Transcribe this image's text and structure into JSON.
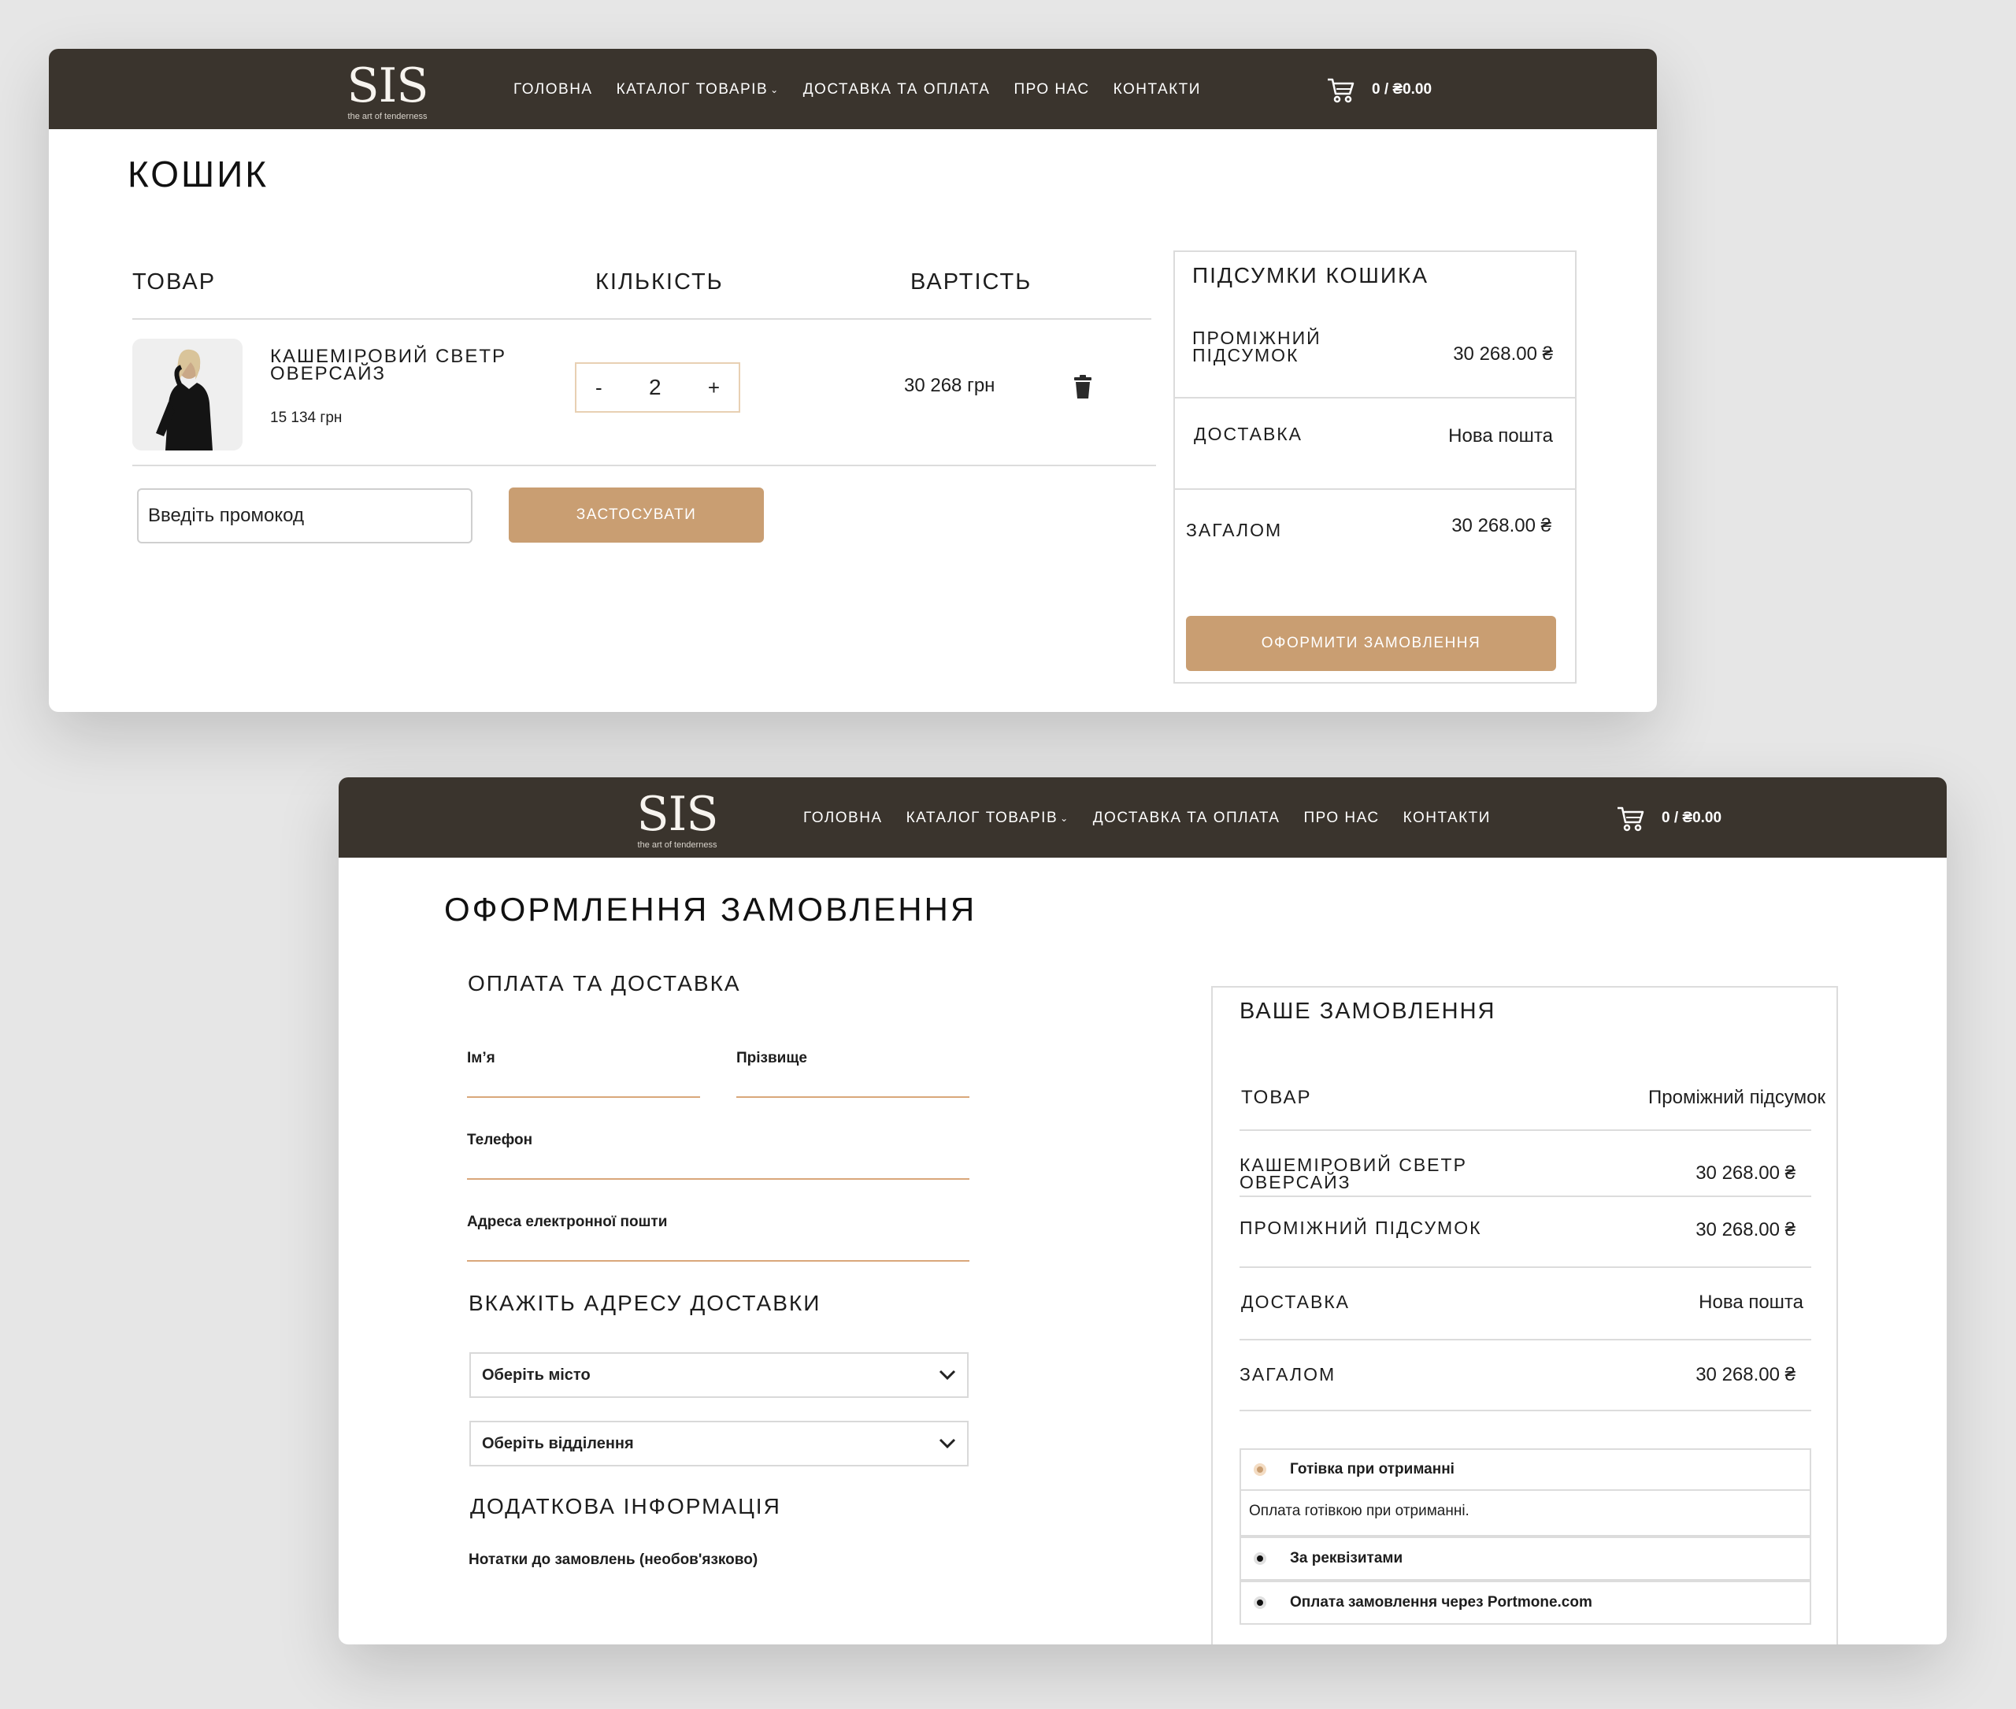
{
  "brand": {
    "logo": "SIS",
    "tagline": "the art of tenderness"
  },
  "nav": {
    "items": [
      "ГОЛОВНА",
      "КАТАЛОГ ТОВАРІВ",
      "ДОСТАВКА ТА ОПЛАТА",
      "ПРО НАС",
      "КОНТАКТИ"
    ],
    "cart": "0 / ₴0.00"
  },
  "cart_page": {
    "title": "КОШИК",
    "columns": {
      "product": "ТОВАР",
      "quantity": "КІЛЬКІСТЬ",
      "price": "ВАРТІСТЬ"
    },
    "item": {
      "name_line1": "КАШЕМІРОВИЙ СВЕТР",
      "name_line2": "ОВЕРСАЙЗ",
      "unit_price": "15 134 грн",
      "qty_minus": "-",
      "qty_value": "2",
      "qty_plus": "+",
      "total": "30 268 грн"
    },
    "promo_placeholder": "Введіть промокод",
    "apply_label": "ЗАСТОСУВАТИ",
    "totals": {
      "title": "ПІДСУМКИ КОШИКА",
      "subtotal_label_line1": "ПРОМІЖНИЙ",
      "subtotal_label_line2": "ПІДСУМОК",
      "subtotal_value": "30 268.00 ₴",
      "shipping_label": "ДОСТАВКА",
      "shipping_value": "Нова пошта",
      "total_label": "ЗАГАЛОМ",
      "total_value": "30 268.00 ₴",
      "checkout_label": "ОФОРМИТИ ЗАМОВЛЕННЯ"
    }
  },
  "checkout_page": {
    "title": "ОФОРМЛЕННЯ ЗАМОВЛЕННЯ",
    "payment_section": "ОПЛАТА ТА ДОСТАВКА",
    "first_name_label": "Ім’я",
    "last_name_label": "Прізвище",
    "phone_label": "Телефон",
    "email_label": "Адреса електронної пошти",
    "address_section": "ВКАЖІТЬ АДРЕСУ ДОСТАВКИ",
    "city_select": "Оберіть місто",
    "branch_select": "Оберіть відділення",
    "extra_section": "ДОДАТКОВА ІНФОРМАЦІЯ",
    "notes_label": "Нотатки до замовлень (необов'язково)",
    "order": {
      "title": "ВАШЕ ЗАМОВЛЕННЯ",
      "col_product": "ТОВАР",
      "col_subtotal": "Проміжний підсумок",
      "item_line1": "КАШЕМІРОВИЙ СВЕТР",
      "item_line2": "ОВЕРСАЙЗ",
      "item_value": "30 268.00 ₴",
      "subtotal_label": "ПРОМІЖНИЙ ПІДСУМОК",
      "subtotal_value": "30 268.00 ₴",
      "shipping_label": "ДОСТАВКА",
      "shipping_value": "Нова пошта",
      "total_label": "ЗАГАЛОМ",
      "total_value": "30 268.00 ₴",
      "payment_options": [
        {
          "label": "Готівка при отриманні",
          "selected": true,
          "description": "Оплата готівкою при отриманні."
        },
        {
          "label": "За реквізитами",
          "selected": false
        },
        {
          "label": "Оплата замовлення через Portmone.com",
          "selected": false
        }
      ]
    }
  },
  "colors": {
    "header": "#3a342d",
    "accent": "#c99e72",
    "field_line": "#d9a77a"
  }
}
